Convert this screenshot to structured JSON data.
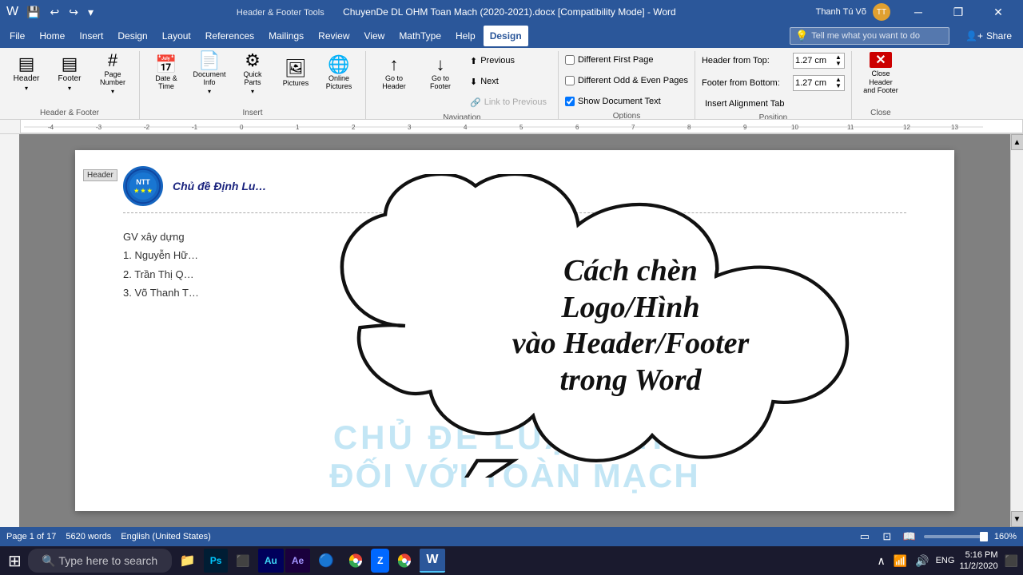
{
  "titlebar": {
    "title": "ChuyenDe DL OHM Toan Mach (2020-2021).docx [Compatibility Mode] - Word",
    "tools_label": "Header & Footer Tools",
    "user": "Thanh Tú Võ",
    "minimize": "─",
    "restore": "❐",
    "close": "✕"
  },
  "menubar": {
    "items": [
      "File",
      "Home",
      "Insert",
      "Design",
      "Layout",
      "References",
      "Mailings",
      "Review",
      "View",
      "MathType",
      "Help"
    ],
    "active_tab": "Design",
    "tell_me_placeholder": "Tell me what you want to do",
    "share_label": "Share"
  },
  "ribbon": {
    "header_footer_group": {
      "label": "Header & Footer",
      "header_btn": "Header",
      "footer_btn": "Footer",
      "page_number_btn": "Page Number"
    },
    "insert_group": {
      "label": "Insert",
      "date_time_btn": "Date & Time",
      "document_info_btn": "Document Info",
      "quick_parts_btn": "Quick Parts",
      "pictures_btn": "Pictures",
      "online_pictures_btn": "Online Pictures"
    },
    "navigation_group": {
      "label": "Navigation",
      "go_to_header_btn": "Go to Header",
      "go_to_footer_btn": "Go to Footer",
      "previous_btn": "Previous",
      "next_btn": "Next",
      "link_to_previous_btn": "Link to Previous"
    },
    "options_group": {
      "label": "Options",
      "different_first_page": "Different First Page",
      "different_odd_even": "Different Odd & Even Pages",
      "show_document_text": "Show Document Text",
      "show_document_text_checked": true
    },
    "position_group": {
      "label": "Position",
      "header_from_top_label": "Header from Top:",
      "header_from_top_value": "1.27 cm",
      "footer_from_bottom_label": "Footer from Bottom:",
      "footer_from_bottom_value": "1.27 cm",
      "insert_alignment_tab": "Insert Alignment Tab"
    },
    "close_group": {
      "label": "Close",
      "close_btn": "Close Header and Footer"
    }
  },
  "document": {
    "header_label": "Header",
    "school_logo_text": "NTT",
    "header_text": "Chủ đề Định Lu…",
    "body_lines": [
      "GV xây dựng",
      "1. Nguyễn Hữ…",
      "2. Trần Thị Q…",
      "3. Võ Thanh T…"
    ],
    "watermark_line1": "CHỦ ĐỀ LUẬT OHM",
    "watermark_line2": "ĐỐI VỚI TOÀN MẠCH",
    "cloud_text": "Cách chèn\nLogo/Hình\nvào Header/Footer\ntrong Word"
  },
  "statusbar": {
    "page_info": "Page 1 of 17",
    "word_count": "5620 words",
    "language": "English (United States)",
    "zoom_level": "160%"
  },
  "taskbar": {
    "apps": [
      {
        "name": "windows-start",
        "icon": "⊞"
      },
      {
        "name": "file-explorer",
        "icon": "📁"
      },
      {
        "name": "photoshop",
        "icon": "Ps"
      },
      {
        "name": "terminal",
        "icon": "⬛"
      },
      {
        "name": "audition",
        "icon": "Au"
      },
      {
        "name": "ae",
        "icon": "Ae"
      },
      {
        "name": "app6",
        "icon": "🔵"
      },
      {
        "name": "chrome",
        "icon": "⊙"
      },
      {
        "name": "zalo",
        "icon": "Z"
      },
      {
        "name": "chrome2",
        "icon": "⊙"
      },
      {
        "name": "word",
        "icon": "W"
      }
    ],
    "sys_tray": {
      "time": "5:16 PM",
      "date": "11/2/2020",
      "lang": "ENG"
    }
  }
}
